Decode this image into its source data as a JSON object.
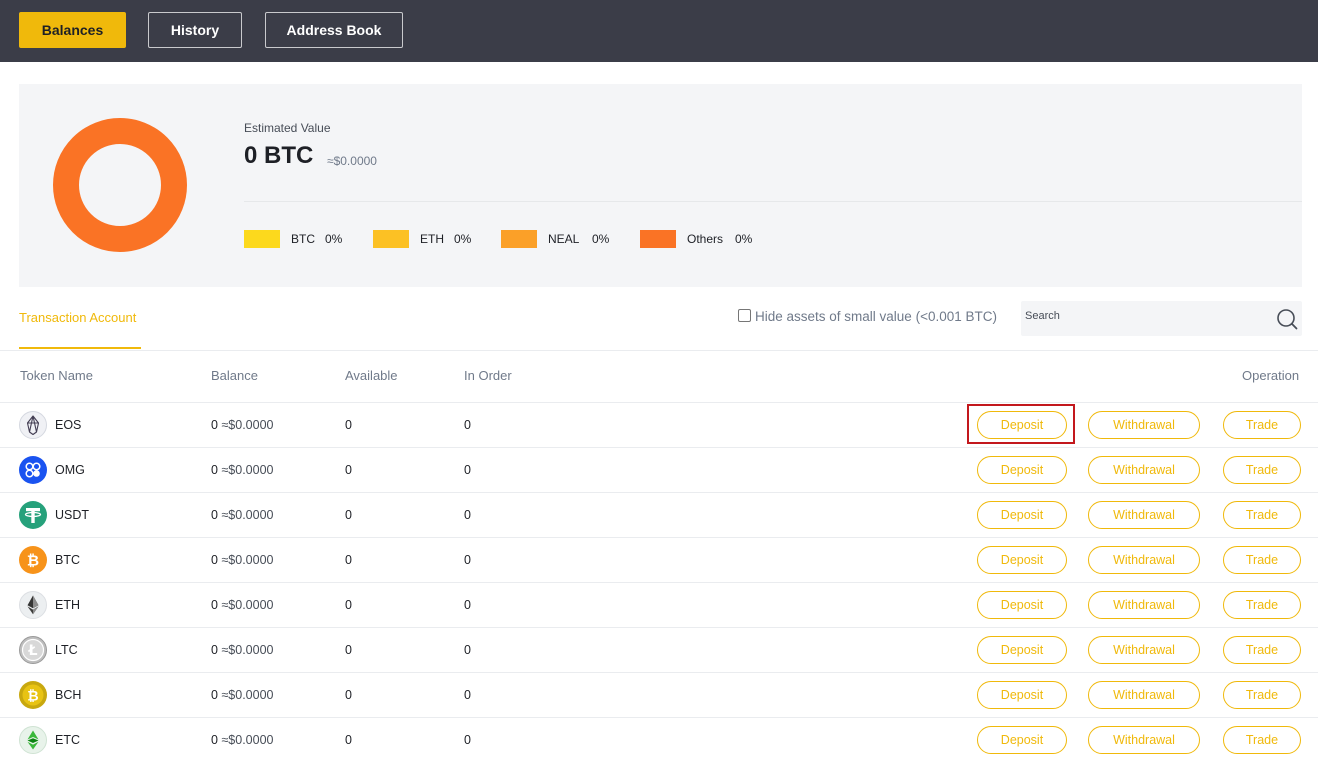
{
  "nav": {
    "tabs": [
      {
        "label": "Balances",
        "active": true
      },
      {
        "label": "History",
        "active": false
      },
      {
        "label": "Address Book",
        "active": false
      }
    ]
  },
  "summary": {
    "estimated_label": "Estimated Value",
    "estimated_value": "0 BTC",
    "estimated_usd": "≈$0.0000",
    "legend": [
      {
        "name": "BTC",
        "percent": "0%",
        "color": "#fcd91d"
      },
      {
        "name": "ETH",
        "percent": "0%",
        "color": "#fcc124"
      },
      {
        "name": "NEAL",
        "percent": "0%",
        "color": "#fba028"
      },
      {
        "name": "Others",
        "percent": "0%",
        "color": "#fa7325"
      }
    ],
    "donut_color": "#fa7325"
  },
  "account": {
    "tab_label": "Transaction Account",
    "hide_small_label": "Hide assets of small value (<0.001 BTC)",
    "hide_small_checked": false,
    "search_placeholder": "Search"
  },
  "table": {
    "headers": {
      "token": "Token Name",
      "balance": "Balance",
      "available": "Available",
      "in_order": "In Order",
      "operation": "Operation"
    },
    "buttons": {
      "deposit": "Deposit",
      "withdrawal": "Withdrawal",
      "trade": "Trade"
    },
    "rows": [
      {
        "token": "EOS",
        "icon": "eos-icon",
        "balance": "0",
        "balance_usd": "≈$0.0000",
        "available": "0",
        "in_order": "0"
      },
      {
        "token": "OMG",
        "icon": "omg-icon",
        "balance": "0",
        "balance_usd": "≈$0.0000",
        "available": "0",
        "in_order": "0"
      },
      {
        "token": "USDT",
        "icon": "usdt-icon",
        "balance": "0",
        "balance_usd": "≈$0.0000",
        "available": "0",
        "in_order": "0"
      },
      {
        "token": "BTC",
        "icon": "btc-icon",
        "balance": "0",
        "balance_usd": "≈$0.0000",
        "available": "0",
        "in_order": "0"
      },
      {
        "token": "ETH",
        "icon": "eth-icon",
        "balance": "0",
        "balance_usd": "≈$0.0000",
        "available": "0",
        "in_order": "0"
      },
      {
        "token": "LTC",
        "icon": "ltc-icon",
        "balance": "0",
        "balance_usd": "≈$0.0000",
        "available": "0",
        "in_order": "0"
      },
      {
        "token": "BCH",
        "icon": "bch-icon",
        "balance": "0",
        "balance_usd": "≈$0.0000",
        "available": "0",
        "in_order": "0"
      },
      {
        "token": "ETC",
        "icon": "etc-icon",
        "balance": "0",
        "balance_usd": "≈$0.0000",
        "available": "0",
        "in_order": "0"
      }
    ]
  },
  "colors": {
    "accent": "#f0b90b",
    "topbar": "#3b3d48",
    "highlight_box": "#c3181d"
  }
}
